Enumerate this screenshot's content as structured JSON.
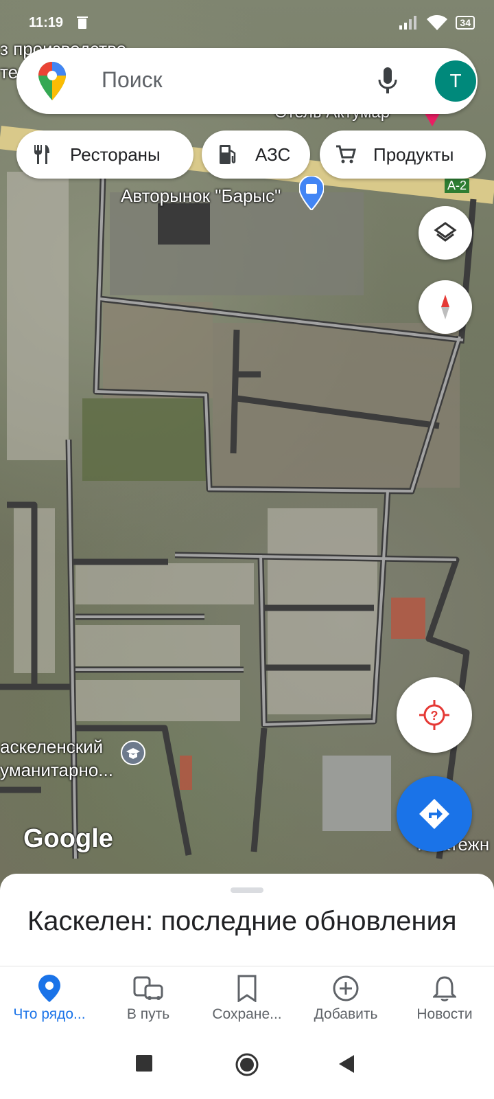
{
  "status_bar": {
    "time": "11:19",
    "battery": "34"
  },
  "search": {
    "placeholder": "Поиск",
    "avatar_letter": "T"
  },
  "chips": [
    {
      "label": "Рестораны",
      "icon": "restaurant-icon"
    },
    {
      "label": "АЗС",
      "icon": "gas-station-icon"
    },
    {
      "label": "Продукты",
      "icon": "cart-icon"
    }
  ],
  "map": {
    "labels": {
      "top_left": "з производство",
      "top_left_2": "те",
      "hotel": "Отель Актумар",
      "market": "Авторынок \"Барыс\"",
      "road": "А-2",
      "school_1": "аскеленский",
      "school_2": "уманитарно...",
      "payment": "Платежн"
    },
    "attribution": "Google"
  },
  "sheet": {
    "title": "Каскелен: последние обновления"
  },
  "bottom_nav": [
    {
      "label": "Что рядо...",
      "icon": "location-pin-icon",
      "active": true
    },
    {
      "label": "В путь",
      "icon": "commute-icon",
      "active": false
    },
    {
      "label": "Сохране...",
      "icon": "bookmark-icon",
      "active": false
    },
    {
      "label": "Добавить",
      "icon": "add-circle-icon",
      "active": false
    },
    {
      "label": "Новости",
      "icon": "bell-icon",
      "active": false
    }
  ],
  "colors": {
    "accent": "#1a73e8",
    "avatar": "#00897b",
    "road": "#d9c98a"
  }
}
